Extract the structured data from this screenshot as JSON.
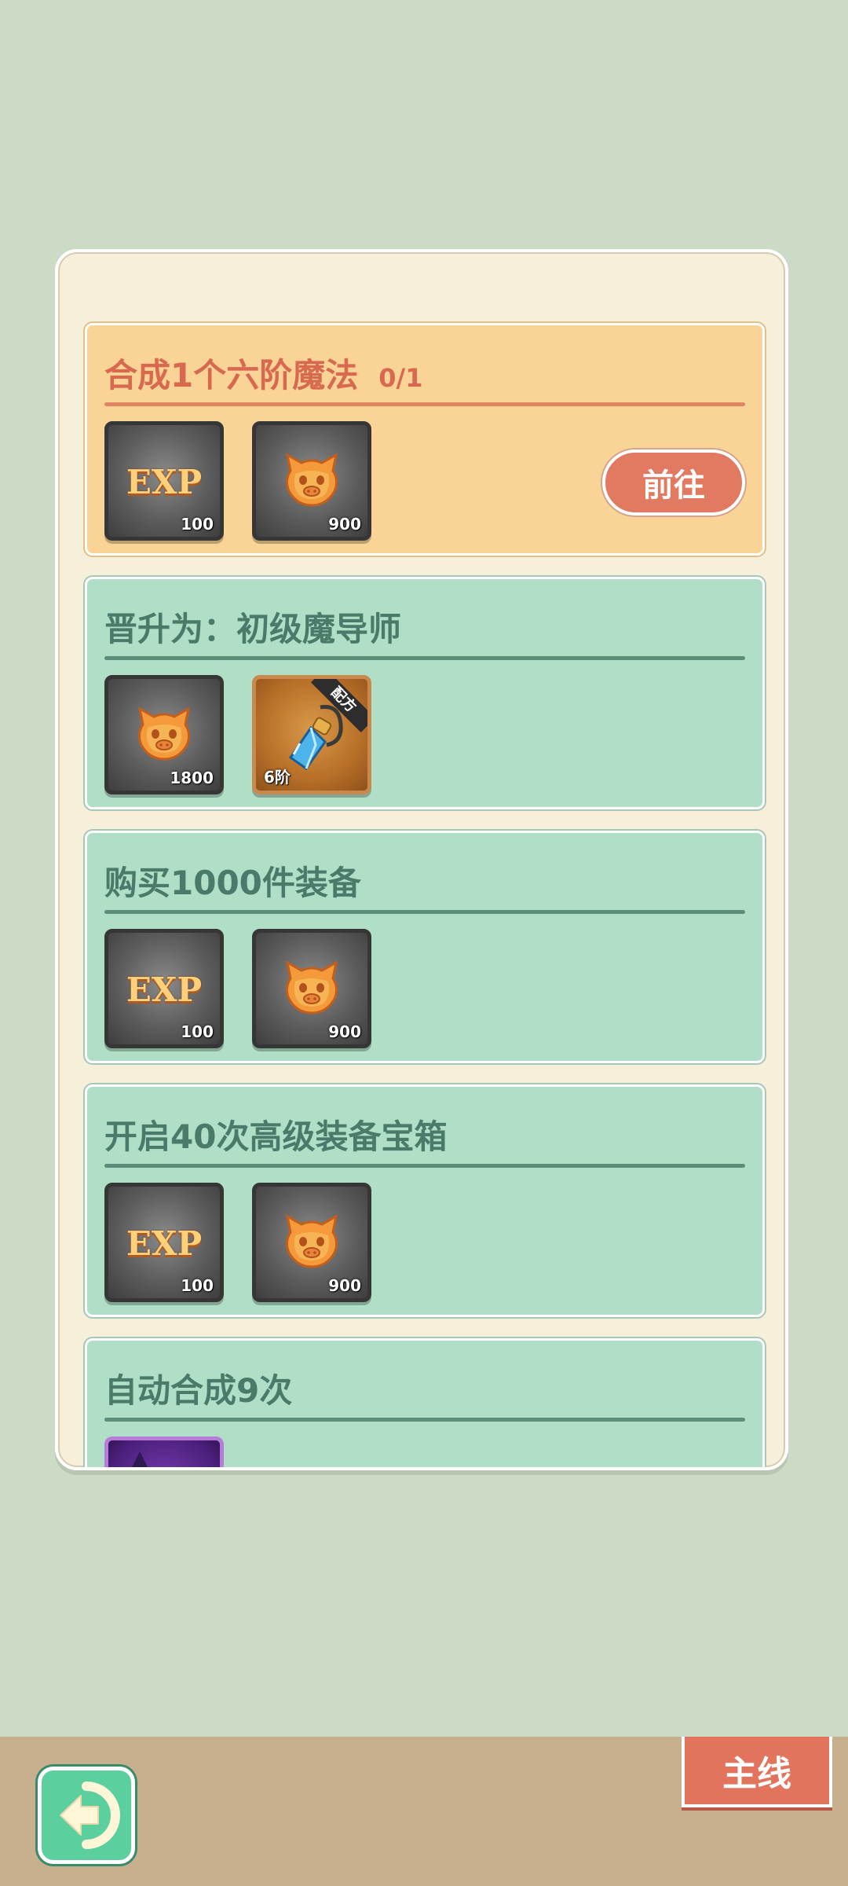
{
  "quests": [
    {
      "title": "合成1个六阶魔法",
      "progress": "0/1",
      "state": "active",
      "rewards": [
        {
          "icon": "exp-icon",
          "label": "EXP",
          "count": "100"
        },
        {
          "icon": "coin-icon",
          "count": "900"
        }
      ],
      "button": "前往"
    },
    {
      "title": "晋升为：初级魔导师",
      "state": "normal",
      "rewards": [
        {
          "icon": "coin-icon",
          "count": "1800"
        },
        {
          "icon": "crystal-pendant-icon",
          "count": "6阶",
          "badge": "配方"
        }
      ]
    },
    {
      "title": "购买1000件装备",
      "state": "normal",
      "rewards": [
        {
          "icon": "exp-icon",
          "label": "EXP",
          "count": "100"
        },
        {
          "icon": "coin-icon",
          "count": "900"
        }
      ]
    },
    {
      "title": "开启40次高级装备宝箱",
      "state": "normal",
      "rewards": [
        {
          "icon": "exp-icon",
          "label": "EXP",
          "count": "100"
        },
        {
          "icon": "coin-icon",
          "count": "900"
        }
      ]
    },
    {
      "title": "自动合成9次",
      "state": "normal",
      "rewards": [
        {
          "icon": "magic-item-icon"
        }
      ]
    }
  ],
  "bottom_bar": {
    "back_icon": "back-arrow-icon",
    "main_tab": "主线"
  },
  "colors": {
    "background": "#ccdbc6",
    "active_card": "#fad497",
    "normal_card": "#b1dec7",
    "go_button": "#e27a62",
    "main_tab": "#e2745d"
  }
}
